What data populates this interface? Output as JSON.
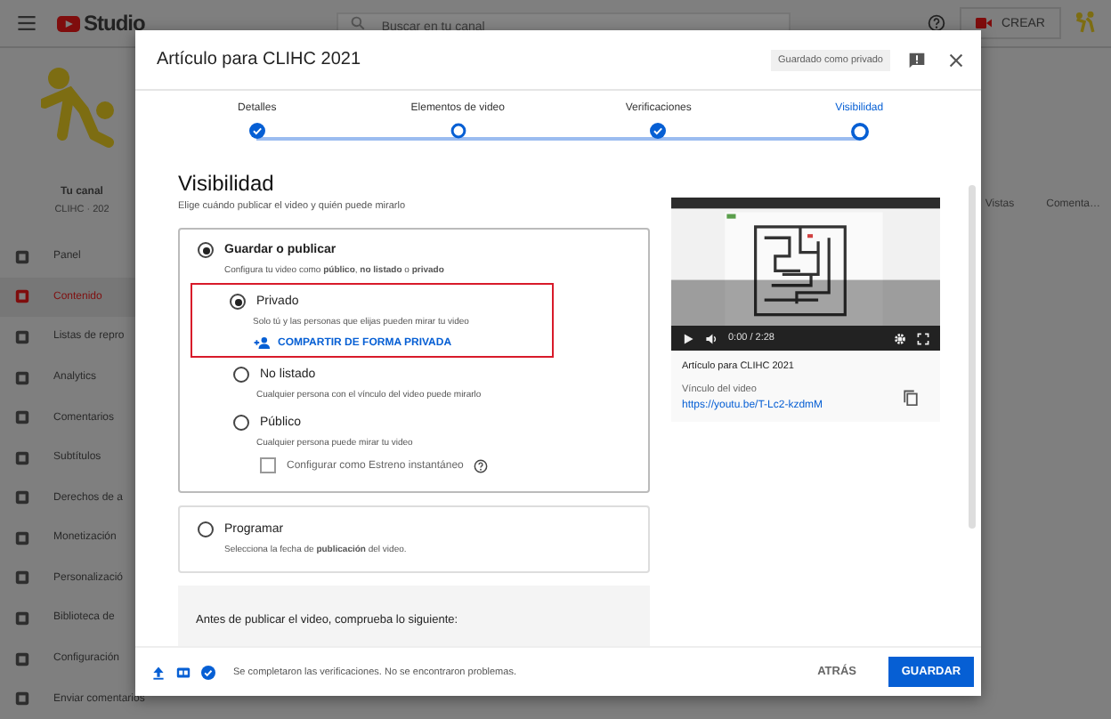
{
  "topbar": {
    "logo": "Studio",
    "search_placeholder": "Buscar en tu canal",
    "create": "CREAR"
  },
  "channel": {
    "title": "Tu canal",
    "name": "CLIHC · 202"
  },
  "sidebar": [
    {
      "label": "Panel",
      "selected": false
    },
    {
      "label": "Contenido",
      "selected": true
    },
    {
      "label": "Listas de repro",
      "selected": false
    },
    {
      "label": "Analytics",
      "selected": false
    },
    {
      "label": "Comentarios",
      "selected": false
    },
    {
      "label": "Subtítulos",
      "selected": false
    },
    {
      "label": "Derechos de a",
      "selected": false
    },
    {
      "label": "Monetización",
      "selected": false
    },
    {
      "label": "Personalizació",
      "selected": false
    },
    {
      "label": "Biblioteca de",
      "selected": false
    },
    {
      "label": "Configuración",
      "selected": false
    },
    {
      "label": "Enviar comentarios",
      "selected": false
    }
  ],
  "table_headers": [
    "Vistas",
    "Comenta…"
  ],
  "dialog": {
    "title": "Artículo para CLIHC 2021",
    "saved_badge": "Guardado como privado",
    "steps": [
      {
        "label": "Detalles",
        "done": true,
        "selected": false
      },
      {
        "label": "Elementos de video",
        "done": false,
        "selected": false
      },
      {
        "label": "Verificaciones",
        "done": true,
        "selected": false
      },
      {
        "label": "Visibilidad",
        "done": false,
        "selected": true
      }
    ],
    "heading": "Visibilidad",
    "subtitle": "Elige cuándo publicar el video y quién puede mirarlo",
    "save_group": {
      "label": "Guardar o publicar",
      "selected": true,
      "description": "Configura tu video como **público**, **no listado** o **privado**",
      "options": [
        {
          "label": "Privado",
          "selected": true,
          "highlighted": true,
          "description": "Solo tú y las personas que elijas pueden mirar tu video",
          "action": "COMPARTIR DE FORMA PRIVADA"
        },
        {
          "label": "No listado",
          "selected": false,
          "highlighted": false,
          "description": "Cualquier persona con el vínculo del video puede mirarlo"
        },
        {
          "label": "Público",
          "selected": false,
          "highlighted": false,
          "description": "Cualquier persona puede mirar tu video",
          "checkbox": {
            "label": "Configurar como Estreno instantáneo",
            "checked": false
          }
        }
      ]
    },
    "schedule": {
      "label": "Programar",
      "selected": false,
      "description": "Selecciona la fecha de **publicación** del video."
    },
    "checklist_title": "Antes de publicar el video, comprueba lo siguiente:",
    "video": {
      "time": "0:00 / 2:28",
      "title": "Artículo para CLIHC 2021",
      "link_label": "Vínculo del video",
      "link": "https://youtu.be/T-Lc2-kzdmM"
    },
    "footer": {
      "status": "Se completaron las verificaciones. No se encontraron problemas.",
      "back": "ATRÁS",
      "save": "GUARDAR"
    }
  }
}
